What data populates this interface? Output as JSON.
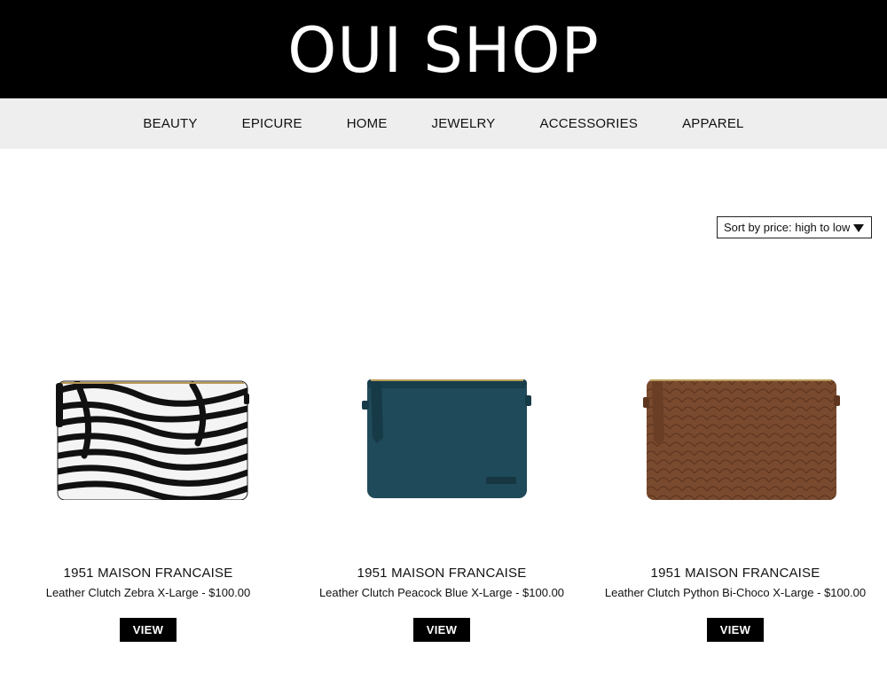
{
  "header": {
    "logo": "OUI SHOP"
  },
  "nav": {
    "items": [
      {
        "label": "BEAUTY"
      },
      {
        "label": "EPICURE"
      },
      {
        "label": "HOME"
      },
      {
        "label": "JEWELRY"
      },
      {
        "label": "ACCESSORIES"
      },
      {
        "label": "APPAREL"
      }
    ]
  },
  "sort": {
    "label": "Sort by price: high to low",
    "arrow_icon": "triangle-down-icon"
  },
  "products": [
    {
      "brand": "1951 MAISON FRANCAISE",
      "name": "Leather Clutch Zebra X-Large",
      "separator": " - ",
      "price": "$100.00",
      "button": "VIEW",
      "image": "zebra-clutch-image"
    },
    {
      "brand": "1951 MAISON FRANCAISE",
      "name": "Leather Clutch Peacock Blue X-Large",
      "separator": " - ",
      "price": "$100.00",
      "button": "VIEW",
      "image": "peacock-blue-clutch-image"
    },
    {
      "brand": "1951 MAISON FRANCAISE",
      "name": "Leather Clutch Python Bi-Choco X-Large",
      "separator": " - ",
      "price": "$100.00",
      "button": "VIEW",
      "image": "python-choco-clutch-image"
    }
  ],
  "colors": {
    "header_bg": "#000000",
    "nav_bg": "#eeeeee",
    "button_bg": "#000000",
    "peacock": "#1f4a59",
    "python": "#7a4a2e"
  }
}
